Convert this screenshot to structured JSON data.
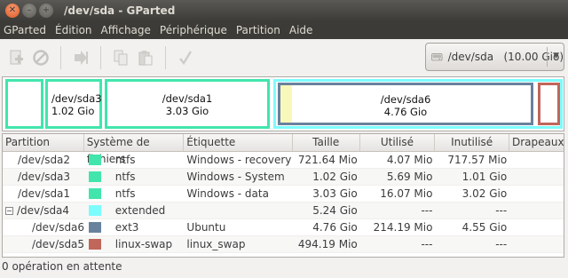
{
  "window": {
    "title": "/dev/sda - GParted"
  },
  "menu": [
    "GParted",
    "Édition",
    "Affichage",
    "Périphérique",
    "Partition",
    "Aide"
  ],
  "device_selector": {
    "label": "/dev/sda   (10.00 Gio)"
  },
  "map": {
    "sda3": {
      "name": "/dev/sda3",
      "size": "1.02 Gio"
    },
    "sda1": {
      "name": "/dev/sda1",
      "size": "3.03 Gio"
    },
    "sda6": {
      "name": "/dev/sda6",
      "size": "4.76 Gio",
      "used_fraction": 0.045
    }
  },
  "table": {
    "columns": [
      "Partition",
      "Système de fichiers",
      "Étiquette",
      "Taille",
      "Utilisé",
      "Inutilisé",
      "Drapeaux"
    ],
    "rows": [
      {
        "partition": "/dev/sda2",
        "fs": "ntfs",
        "color": "#42e5ac",
        "label": "Windows - recovery",
        "size": "721.64 Mio",
        "used": "4.07 Mio",
        "unused": "717.57 Mio",
        "flags": ""
      },
      {
        "partition": "/dev/sda3",
        "fs": "ntfs",
        "color": "#42e5ac",
        "label": "Windows - System",
        "size": "1.02 Gio",
        "used": "5.69 Mio",
        "unused": "1.01 Gio",
        "flags": ""
      },
      {
        "partition": "/dev/sda1",
        "fs": "ntfs",
        "color": "#42e5ac",
        "label": "Windows - data",
        "size": "3.03 Gio",
        "used": "16.07 Mio",
        "unused": "3.02 Gio",
        "flags": ""
      },
      {
        "partition": "/dev/sda4",
        "fs": "extended",
        "color": "#7dfcfe",
        "label": "",
        "size": "5.24 Gio",
        "used": "---",
        "unused": "---",
        "flags": ""
      },
      {
        "partition": "/dev/sda6",
        "fs": "ext3",
        "color": "#68829d",
        "label": "Ubuntu",
        "size": "4.76 Gio",
        "used": "214.19 Mio",
        "unused": "4.55 Gio",
        "flags": ""
      },
      {
        "partition": "/dev/sda5",
        "fs": "linux-swap",
        "color": "#c1665a",
        "label": "linux_swap",
        "size": "494.19 Mio",
        "used": "---",
        "unused": "---",
        "flags": ""
      }
    ]
  },
  "status": {
    "text": "0 opération en attente"
  },
  "colors": {
    "ntfs": "#42e5ac",
    "extended": "#7dfcfe",
    "ext3": "#68829d",
    "linux_swap": "#c1665a",
    "titlebar": "#3c3b37"
  }
}
